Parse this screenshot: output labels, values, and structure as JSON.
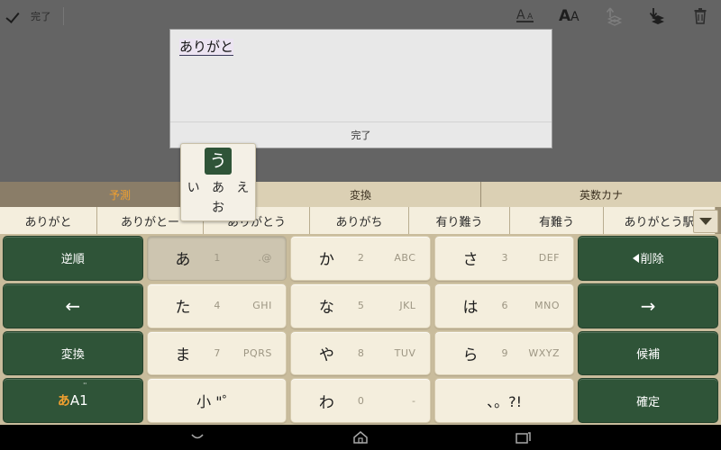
{
  "toolbar": {
    "done_label": "完了",
    "check_icon": "check-icon",
    "icons": [
      {
        "name": "decrease-font-size-icon",
        "glyph": "A"
      },
      {
        "name": "increase-font-size-icon",
        "glyph": "A"
      },
      {
        "name": "bring-to-front-icon",
        "glyph": "↑"
      },
      {
        "name": "send-to-back-icon",
        "glyph": "↓"
      },
      {
        "name": "delete-trash-icon",
        "glyph": "🗑"
      }
    ]
  },
  "editor": {
    "composition_text": "ありがと",
    "done_label": "完了"
  },
  "flick_popup": {
    "center": "う",
    "left": "い",
    "middle": "あ",
    "right": "え",
    "bottom": "お"
  },
  "candidate_tabs": [
    {
      "label": "予測",
      "active": true
    },
    {
      "label": "変換",
      "active": false
    },
    {
      "label": "英数カナ",
      "active": false
    }
  ],
  "candidates": [
    "ありがと",
    "ありがとー",
    "ありがとう",
    "ありがち",
    "有り難う",
    "有難う",
    "ありがとう駅"
  ],
  "candidate_expand_icon": "chevron-down-icon",
  "keyboard": {
    "rows": [
      [
        {
          "type": "fn",
          "label": "逆順",
          "name": "reverse-order-key"
        },
        {
          "type": "chr",
          "kana": "あ",
          "num": "1",
          "alpha": ".@",
          "name": "key-a-row",
          "pressed": true
        },
        {
          "type": "chr",
          "kana": "か",
          "num": "2",
          "alpha": "ABC",
          "name": "key-ka-row",
          "pressed": false
        },
        {
          "type": "chr",
          "kana": "さ",
          "num": "3",
          "alpha": "DEF",
          "name": "key-sa-row",
          "pressed": false
        },
        {
          "type": "del",
          "label": "削除",
          "name": "delete-key"
        }
      ],
      [
        {
          "type": "arrow",
          "label": "←",
          "name": "cursor-left-key"
        },
        {
          "type": "chr",
          "kana": "た",
          "num": "4",
          "alpha": "GHI",
          "name": "key-ta-row",
          "pressed": false
        },
        {
          "type": "chr",
          "kana": "な",
          "num": "5",
          "alpha": "JKL",
          "name": "key-na-row",
          "pressed": false
        },
        {
          "type": "chr",
          "kana": "は",
          "num": "6",
          "alpha": "MNO",
          "name": "key-ha-row",
          "pressed": false
        },
        {
          "type": "arrow",
          "label": "→",
          "name": "cursor-right-key"
        }
      ],
      [
        {
          "type": "fn",
          "label": "変換",
          "name": "convert-key"
        },
        {
          "type": "chr",
          "kana": "ま",
          "num": "7",
          "alpha": "PQRS",
          "name": "key-ma-row",
          "pressed": false
        },
        {
          "type": "chr",
          "kana": "や",
          "num": "8",
          "alpha": "TUV",
          "name": "key-ya-row",
          "pressed": false
        },
        {
          "type": "chr",
          "kana": "ら",
          "num": "9",
          "alpha": "WXYZ",
          "name": "key-ra-row",
          "pressed": false
        },
        {
          "type": "fn",
          "label": "候補",
          "name": "candidate-key"
        }
      ],
      [
        {
          "type": "mode",
          "label_a": "あ",
          "label_b": "A1",
          "dots": "¨",
          "name": "input-mode-key"
        },
        {
          "type": "center",
          "label": "小 \"゜",
          "name": "small-dakuten-key"
        },
        {
          "type": "chr",
          "kana": "わ",
          "num": "0",
          "alpha": "-",
          "name": "key-wa-row",
          "pressed": false
        },
        {
          "type": "center",
          "label": "、。?!",
          "name": "punctuation-key"
        },
        {
          "type": "fn",
          "label": "確定",
          "name": "confirm-key"
        }
      ]
    ]
  },
  "navbar": {
    "items": [
      {
        "name": "hide-keyboard-icon"
      },
      {
        "name": "home-icon"
      },
      {
        "name": "recent-apps-icon"
      }
    ]
  },
  "colors": {
    "accent_orange": "#f0a030",
    "key_green": "#2f5438",
    "key_beige": "#f4eedd",
    "keyboard_bg": "#c9bc9c",
    "toolbar_gray": "#646464"
  }
}
